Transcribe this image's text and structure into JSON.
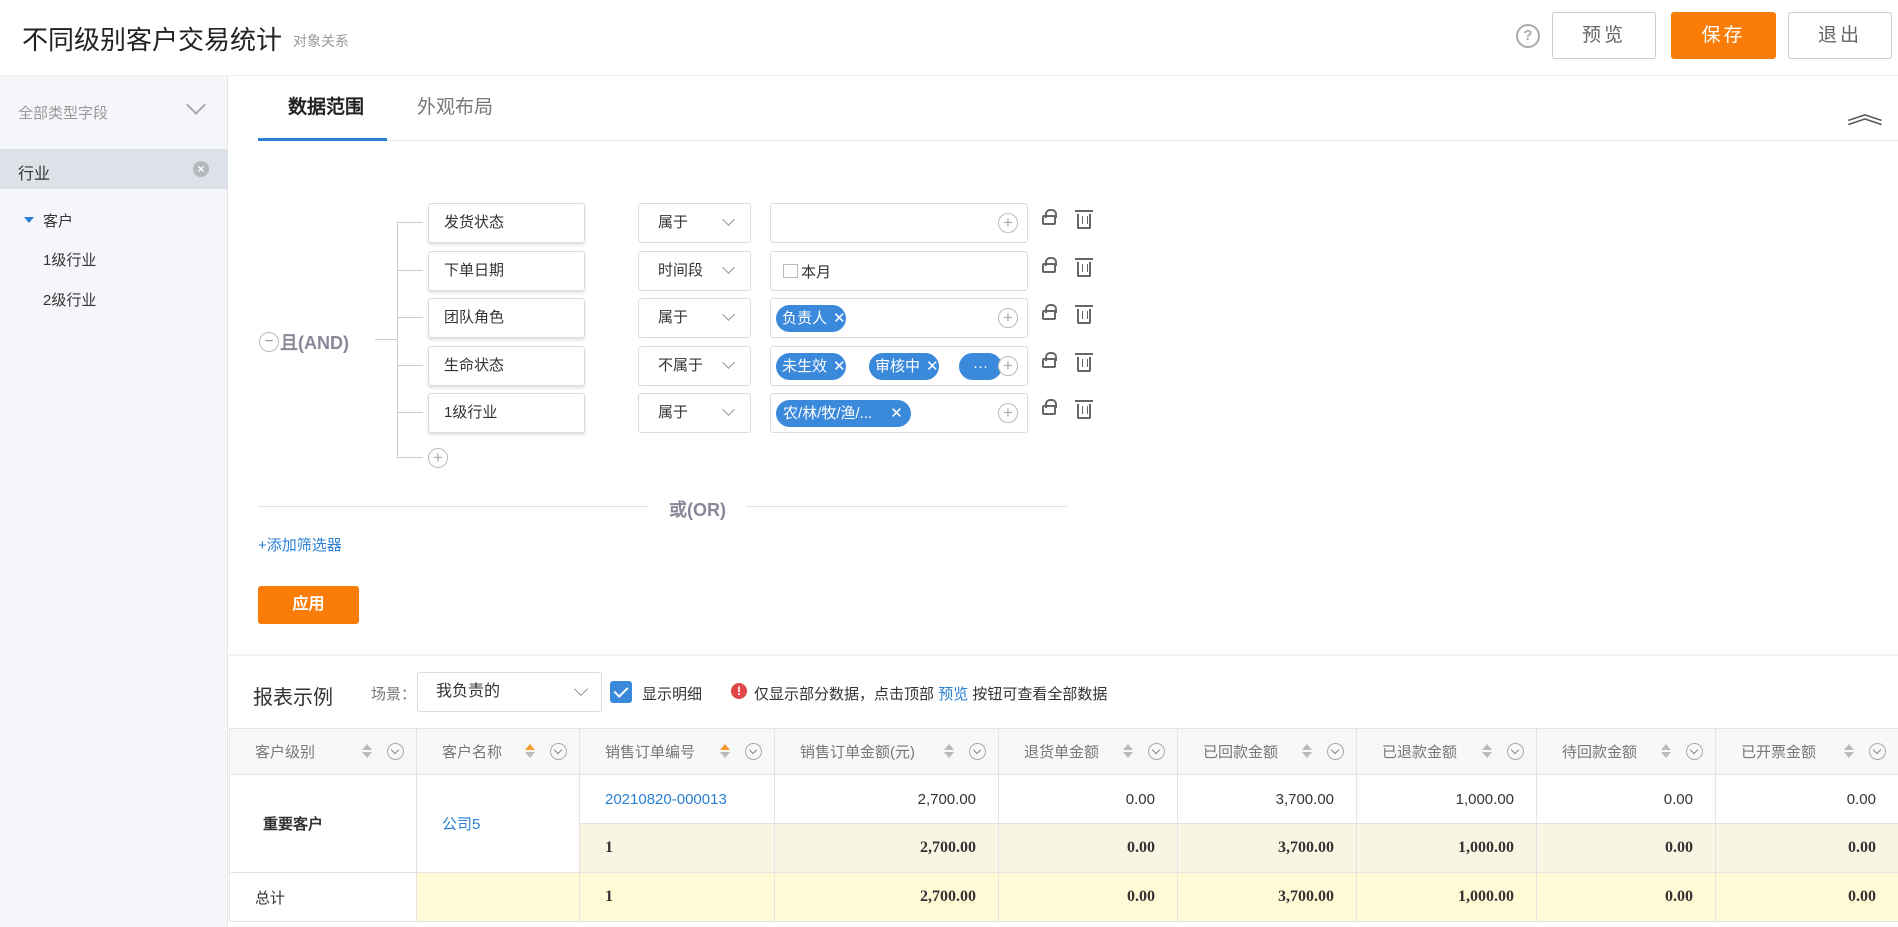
{
  "header": {
    "title": "不同级别客户交易统计",
    "subtitle": "对象关系",
    "help_icon": "question-circle-icon",
    "preview_label": "预览",
    "save_label": "保存",
    "exit_label": "退出",
    "accent_color": "#fa7d09"
  },
  "sidebar": {
    "filter_label": "全部类型字段",
    "selected_label": "行业",
    "tree_root": "客户",
    "tree_children": [
      "1级行业",
      "2级行业"
    ]
  },
  "tabs": [
    {
      "label": "数据范围",
      "active": true
    },
    {
      "label": "外观布局",
      "active": false
    }
  ],
  "conditions": {
    "logic_label": "且(AND)",
    "rows": [
      {
        "field": "发货状态",
        "operator": "属于",
        "tags": []
      },
      {
        "field": "下单日期",
        "operator": "时间段",
        "value_text": "本月"
      },
      {
        "field": "团队角色",
        "operator": "属于",
        "tags": [
          "负责人"
        ]
      },
      {
        "field": "生命状态",
        "operator": "不属于",
        "tags": [
          "未生效",
          "审核中",
          "···"
        ]
      },
      {
        "field": "1级行业",
        "operator": "属于",
        "tags": [
          "农/林/牧/渔/..."
        ]
      }
    ],
    "tag_remove_glyph": "✕",
    "or_label": "或(OR)",
    "add_filter_label": "+添加筛选器",
    "apply_label": "应用"
  },
  "report": {
    "title": "报表示例",
    "scene_label": "场景：",
    "scene_value": "我负责的",
    "show_detail_label": "显示明细",
    "show_detail_checked": true,
    "notice_prefix": "仅显示部分数据，点击顶部",
    "notice_link": "预览",
    "notice_suffix": "按钮可查看全部数据",
    "columns": [
      "客户级别",
      "客户名称",
      "销售订单编号",
      "销售订单金额(元)",
      "退货单金额",
      "已回款金额",
      "已退款金额",
      "待回款金额",
      "已开票金额"
    ],
    "detail_row": {
      "level": "重要客户",
      "customer": "公司5",
      "order_no": "20210820-000013",
      "values": [
        "2,700.00",
        "0.00",
        "3,700.00",
        "1,000.00",
        "0.00",
        "0.00"
      ]
    },
    "subtotal_row": {
      "count": "1",
      "values": [
        "2,700.00",
        "0.00",
        "3,700.00",
        "1,000.00",
        "0.00",
        "0.00"
      ]
    },
    "total_row": {
      "label": "总计",
      "count": "1",
      "values": [
        "2,700.00",
        "0.00",
        "3,700.00",
        "1,000.00",
        "0.00",
        "0.00"
      ]
    }
  }
}
